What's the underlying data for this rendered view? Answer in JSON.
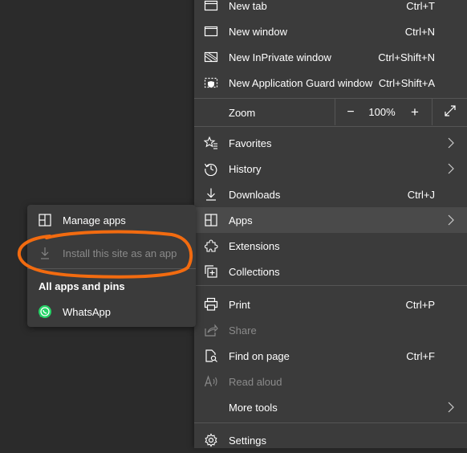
{
  "menu": {
    "items": [
      {
        "label": "New tab",
        "shortcut": "Ctrl+T",
        "icon": "new-tab-icon"
      },
      {
        "label": "New window",
        "shortcut": "Ctrl+N",
        "icon": "new-window-icon"
      },
      {
        "label": "New InPrivate window",
        "shortcut": "Ctrl+Shift+N",
        "icon": "inprivate-icon"
      },
      {
        "label": "New Application Guard window",
        "shortcut": "Ctrl+Shift+A",
        "icon": "application-guard-icon"
      },
      {
        "label": "Favorites",
        "icon": "favorites-icon"
      },
      {
        "label": "History",
        "icon": "history-icon"
      },
      {
        "label": "Downloads",
        "shortcut": "Ctrl+J",
        "icon": "download-icon"
      },
      {
        "label": "Apps",
        "icon": "apps-icon"
      },
      {
        "label": "Extensions",
        "icon": "extensions-icon"
      },
      {
        "label": "Collections",
        "icon": "collections-icon"
      },
      {
        "label": "Print",
        "shortcut": "Ctrl+P",
        "icon": "print-icon"
      },
      {
        "label": "Share",
        "icon": "share-icon"
      },
      {
        "label": "Find on page",
        "shortcut": "Ctrl+F",
        "icon": "find-icon"
      },
      {
        "label": "Read aloud",
        "icon": "read-aloud-icon"
      },
      {
        "label": "More tools",
        "icon": "more-tools-icon"
      },
      {
        "label": "Settings",
        "icon": "gear-icon"
      }
    ],
    "zoom": {
      "label": "Zoom",
      "minus": "−",
      "value": "100%",
      "plus": "+"
    }
  },
  "submenu": {
    "manage_apps": "Manage apps",
    "install_site": "Install this site as an app",
    "heading": "All apps and pins",
    "whatsapp": "WhatsApp"
  },
  "colors": {
    "menu_bg": "#3b3b3b",
    "selected_bg": "#4a4a4a",
    "disabled_text": "#8a8a8a",
    "annotation": "#f26b10",
    "whatsapp_green": "#25d366"
  }
}
